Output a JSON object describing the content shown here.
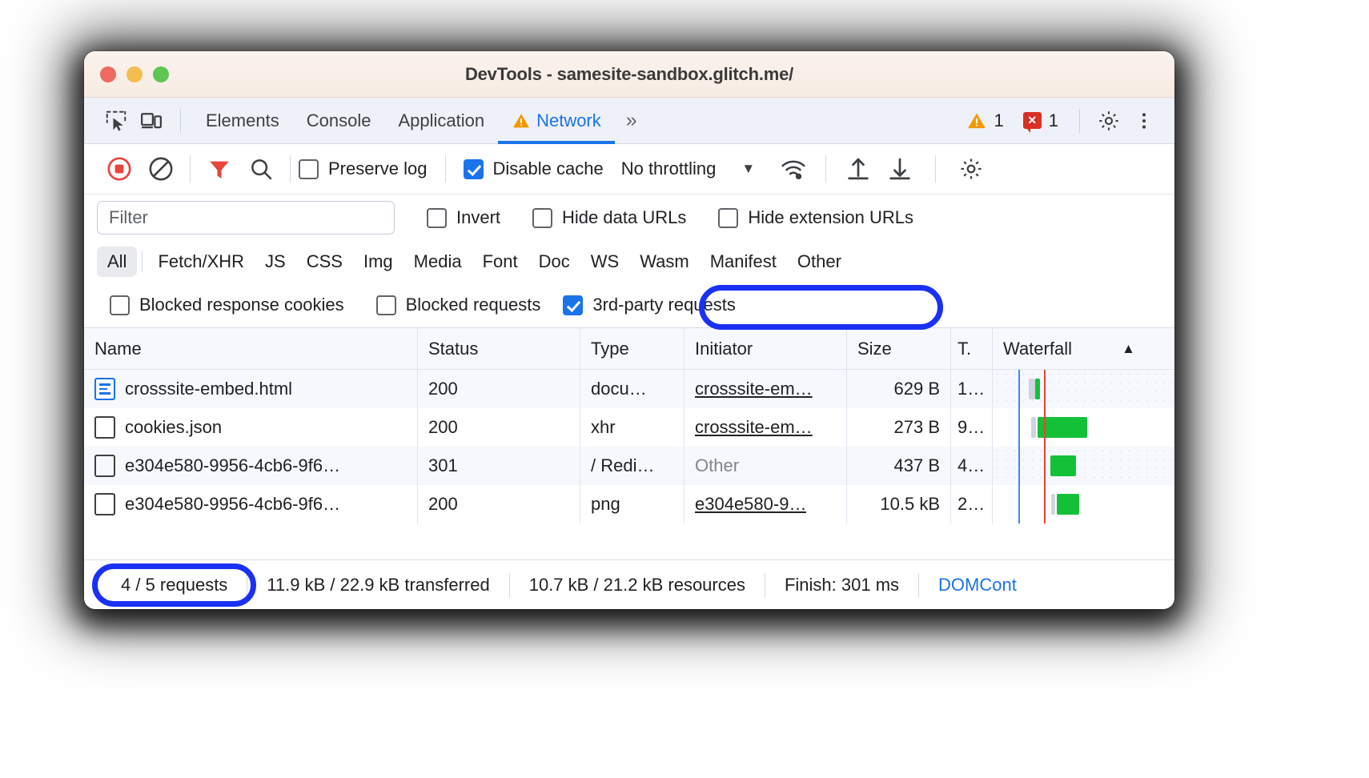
{
  "window": {
    "title": "DevTools - samesite-sandbox.glitch.me/",
    "traffic_lights": [
      "close",
      "minimize",
      "maximize"
    ]
  },
  "tabbar": {
    "icons": [
      "inspect-element-icon",
      "device-toolbar-icon"
    ],
    "tabs": [
      {
        "label": "Elements",
        "selected": false,
        "warning": false
      },
      {
        "label": "Console",
        "selected": false,
        "warning": false
      },
      {
        "label": "Application",
        "selected": false,
        "warning": false
      },
      {
        "label": "Network",
        "selected": true,
        "warning": true
      }
    ],
    "more_tabs": "»",
    "warning_count": "1",
    "error_count": "1",
    "settings_icon": "gear-icon",
    "more_icon": "kebab-menu-icon"
  },
  "network_toolbar": {
    "record_icon": "record-stop-icon",
    "clear_icon": "clear-icon",
    "filter_icon": "funnel-icon",
    "search_icon": "search-icon",
    "preserve_log": {
      "label": "Preserve log",
      "checked": false
    },
    "disable_cache": {
      "label": "Disable cache",
      "checked": true
    },
    "throttling": "No throttling",
    "throttling_caret": "▼",
    "network_conditions_icon": "wifi-settings-icon",
    "import_icon": "import-har-icon",
    "export_icon": "export-har-icon",
    "settings_icon": "gear-icon"
  },
  "filter_row": {
    "placeholder": "Filter",
    "value": "",
    "invert": {
      "label": "Invert",
      "checked": false
    },
    "hide_data_urls": {
      "label": "Hide data URLs",
      "checked": false
    },
    "hide_extension_urls": {
      "label": "Hide extension URLs",
      "checked": false
    }
  },
  "type_filters": [
    {
      "label": "All",
      "active": true
    },
    {
      "label": "Fetch/XHR",
      "active": false
    },
    {
      "label": "JS",
      "active": false
    },
    {
      "label": "CSS",
      "active": false
    },
    {
      "label": "Img",
      "active": false
    },
    {
      "label": "Media",
      "active": false
    },
    {
      "label": "Font",
      "active": false
    },
    {
      "label": "Doc",
      "active": false
    },
    {
      "label": "WS",
      "active": false
    },
    {
      "label": "Wasm",
      "active": false
    },
    {
      "label": "Manifest",
      "active": false
    },
    {
      "label": "Other",
      "active": false
    }
  ],
  "cookie_row": {
    "blocked_response_cookies": {
      "label": "Blocked response cookies",
      "checked": false
    },
    "blocked_requests": {
      "label": "Blocked requests",
      "checked": false
    },
    "third_party_requests": {
      "label": "3rd-party requests",
      "checked": true,
      "highlighted": true
    }
  },
  "table": {
    "columns": [
      {
        "key": "name",
        "label": "Name"
      },
      {
        "key": "status",
        "label": "Status"
      },
      {
        "key": "type",
        "label": "Type"
      },
      {
        "key": "initiator",
        "label": "Initiator"
      },
      {
        "key": "size",
        "label": "Size"
      },
      {
        "key": "time",
        "label": "T."
      },
      {
        "key": "waterfall",
        "label": "Waterfall",
        "sort_indicator": "▲"
      }
    ],
    "rows": [
      {
        "icon": "document-icon",
        "name": "crosssite-embed.html",
        "status": "200",
        "type": "docu…",
        "initiator": "crosssite-em…",
        "initiator_is_link": true,
        "size": "629 B",
        "time": "1…"
      },
      {
        "icon": "file-icon",
        "name": "cookies.json",
        "status": "200",
        "type": "xhr",
        "initiator": "crosssite-em…",
        "initiator_is_link": true,
        "size": "273 B",
        "time": "9…"
      },
      {
        "icon": "file-icon",
        "name": "e304e580-9956-4cb6-9f6…",
        "status": "301",
        "type": "/ Redi…",
        "initiator": "Other",
        "initiator_is_link": false,
        "size": "437 B",
        "time": "4…"
      },
      {
        "icon": "file-icon",
        "name": "e304e580-9956-4cb6-9f6…",
        "status": "200",
        "type": "png",
        "initiator": "e304e580-9…",
        "initiator_is_link": true,
        "size": "10.5 kB",
        "time": "2…"
      }
    ]
  },
  "statusbar": {
    "requests": "4 / 5 requests",
    "requests_highlighted": true,
    "transferred": "11.9 kB / 22.9 kB transferred",
    "resources": "10.7 kB / 21.2 kB resources",
    "finish": "Finish: 301 ms",
    "domcontentloaded": "DOMCont"
  },
  "colors": {
    "accent_blue": "#1a73e8",
    "annotation_blue": "#1a31f5",
    "warning_orange": "#f29900",
    "error_red": "#d93025",
    "record_red": "#e8453c",
    "waterfall_green": "#14c038",
    "waterfall_blue_line": "#4285f4",
    "waterfall_red_line": "#ea4335"
  }
}
